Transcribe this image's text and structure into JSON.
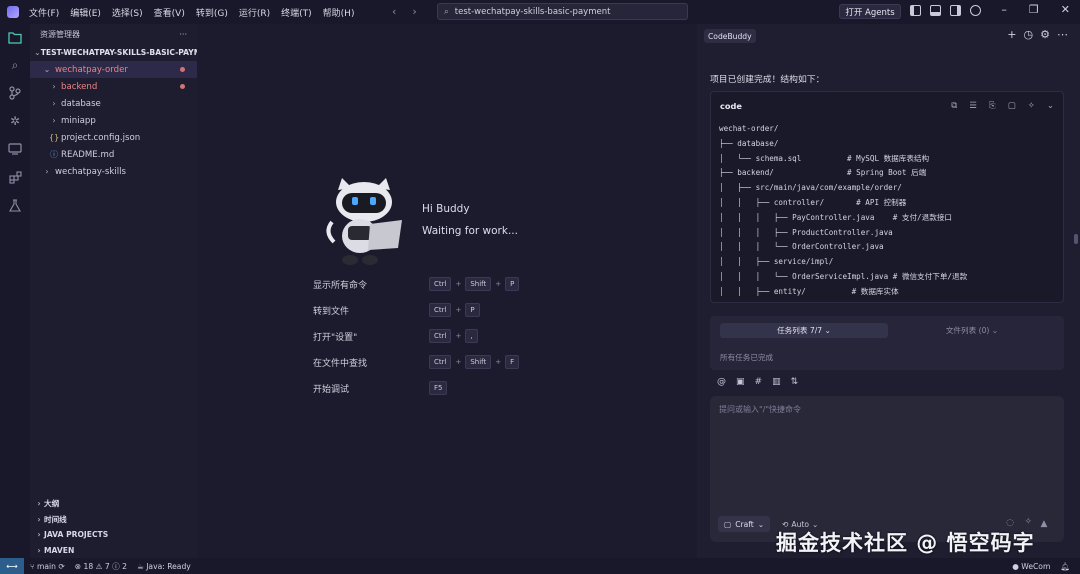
{
  "app": {
    "menu": [
      "文件(F)",
      "编辑(E)",
      "选择(S)",
      "查看(V)",
      "转到(G)",
      "运行(R)",
      "终端(T)",
      "帮助(H)"
    ],
    "search_text": "test-wechatpay-skills-basic-payment",
    "agents_button": "打开 Agents",
    "accent": "#4ec9b0"
  },
  "sidebar": {
    "title": "资源管理器",
    "more": "···",
    "root": "TEST-WECHATPAY-SKILLS-BASIC-PAYM...",
    "items": [
      {
        "label": "wechatpay-order"
      },
      {
        "label": "backend"
      },
      {
        "label": "database"
      },
      {
        "label": "miniapp"
      },
      {
        "label": "project.config.json"
      },
      {
        "label": "README.md"
      },
      {
        "label": "wechatpay-skills"
      }
    ],
    "bottom": [
      "大纲",
      "时间线",
      "JAVA PROJECTS",
      "MAVEN"
    ]
  },
  "editor": {
    "hi": "Hi Buddy",
    "waiting": "Waiting for work...",
    "shortcuts": [
      {
        "label": "显示所有命令",
        "keys": [
          "Ctrl",
          "Shift",
          "P"
        ]
      },
      {
        "label": "转到文件",
        "keys": [
          "Ctrl",
          "P"
        ]
      },
      {
        "label": "打开\"设置\"",
        "keys": [
          "Ctrl",
          ","
        ]
      },
      {
        "label": "在文件中查找",
        "keys": [
          "Ctrl",
          "Shift",
          "F"
        ]
      },
      {
        "label": "开始调试",
        "keys": [
          "F5"
        ]
      }
    ]
  },
  "panel": {
    "tag": "CodeBuddy",
    "message": "项目已创建完成！结构如下：",
    "code_title": "code",
    "code": "wechat-order/\n├── database/\n│   └── schema.sql          # MySQL 数据库表结构\n├── backend/                # Spring Boot 后端\n│   ├── src/main/java/com/example/order/\n│   │   ├── controller/       # API 控制器\n│   │   │   ├── PayController.java    # 支付/退款接口\n│   │   │   ├── ProductController.java\n│   │   │   └── OrderController.java\n│   │   ├── service/impl/\n│   │   │   └── OrderServiceImpl.java # 微信支付下单/退款\n│   │   ├── entity/          # 数据库实体",
    "tab_tasks": "任务列表 7/7",
    "tab_files": "文件列表 (0)",
    "all_done": "所有任务已完成",
    "input_placeholder": "提问或输入\"/\"快捷命令",
    "craft": "Craft",
    "auto": "Auto"
  },
  "status": {
    "branch": "main",
    "errors": "18",
    "warnings": "7",
    "infos": "2",
    "java": "Java: Ready",
    "wecom": "WeCom"
  },
  "watermark": "掘金技术社区 @ 悟空码字"
}
